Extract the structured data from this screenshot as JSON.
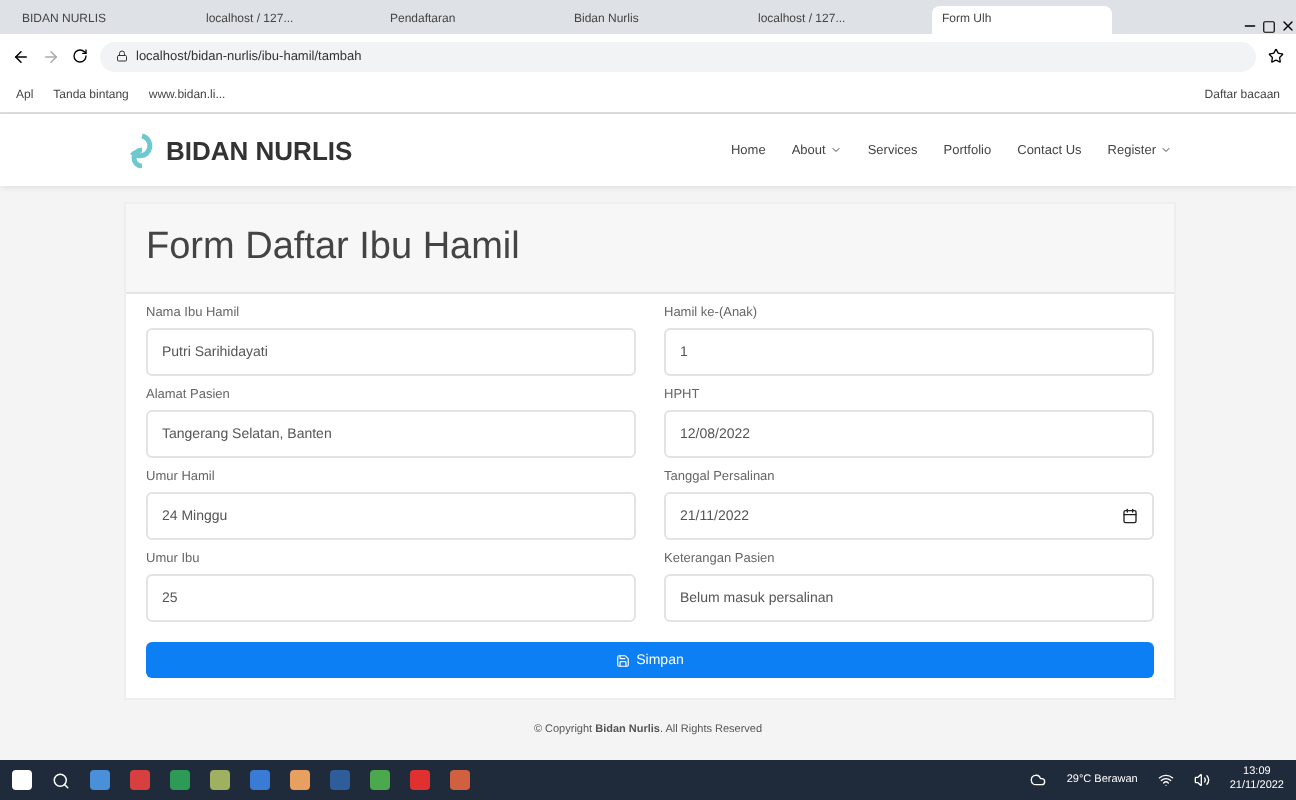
{
  "browser": {
    "tabs": [
      {
        "title": "BIDAN NURLIS",
        "selected": false
      },
      {
        "title": "localhost / 127...",
        "selected": false
      },
      {
        "title": "Pendaftaran",
        "selected": false
      },
      {
        "title": "Bidan Nurlis",
        "selected": false
      },
      {
        "title": "localhost / 127...",
        "selected": false
      },
      {
        "title": "Form Ulh",
        "selected": true
      }
    ],
    "url": "localhost/bidan-nurlis/ibu-hamil/tambah",
    "bookmarks": [
      "Apl",
      "Tanda bintang",
      "www.bidan.li..."
    ],
    "reading_list": "Daftar bacaan"
  },
  "site": {
    "brand": "BIDAN NURLIS",
    "nav": [
      {
        "label": "Home",
        "dropdown": false
      },
      {
        "label": "About",
        "dropdown": true
      },
      {
        "label": "Services",
        "dropdown": false
      },
      {
        "label": "Portfolio",
        "dropdown": false
      },
      {
        "label": "Contact Us",
        "dropdown": false
      },
      {
        "label": "Register",
        "dropdown": true
      }
    ]
  },
  "form": {
    "title": "Form Daftar Ibu Hamil",
    "fields": [
      {
        "label": "Nama Ibu Hamil",
        "value": "Putri Sarihidayati",
        "kind": "text"
      },
      {
        "label": "Hamil ke-(Anak)",
        "value": "1",
        "kind": "text"
      },
      {
        "label": "Alamat Pasien",
        "value": "Tangerang Selatan, Banten",
        "kind": "text"
      },
      {
        "label": "HPHT",
        "value": "12/08/2022",
        "kind": "text"
      },
      {
        "label": "Umur Hamil",
        "value": "24 Minggu",
        "kind": "text"
      },
      {
        "label": "Tanggal Persalinan",
        "value": "21/11/2022",
        "kind": "date"
      },
      {
        "label": "Umur Ibu",
        "value": "25",
        "kind": "text"
      },
      {
        "label": "Keterangan Pasien",
        "value": "Belum masuk persalinan",
        "kind": "text"
      }
    ],
    "submit": "Simpan"
  },
  "footer": "© Copyright **Bidan Nurlis**. All Rights Reserved",
  "taskbar": {
    "weather": "29°C Berawan",
    "time": "13:09",
    "date": "21/11/2022"
  }
}
